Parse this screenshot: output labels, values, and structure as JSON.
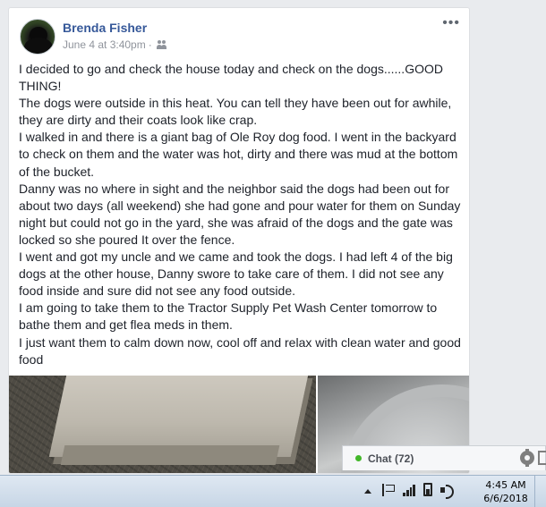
{
  "post": {
    "author": "Brenda Fisher",
    "timestamp": "June 4 at 3:40pm",
    "separator": "·",
    "more_label": "•••",
    "paragraphs": [
      "I decided to go and check the house today and check on the dogs......GOOD THING!",
      "The dogs were outside in this heat. You can tell they have been out for awhile, they are dirty and their coats look like crap.",
      "I walked in and there is a giant bag of Ole Roy dog food. I went in the backyard to check on them and the water was hot, dirty and there was mud at the bottom of the bucket.",
      "Danny was no where in sight and the neighbor said the dogs had been out for about two days (all weekend) she had gone and pour water for them on Sunday night but could not go in the yard, she was afraid of the dogs and the gate was locked so she poured It over the fence.",
      "I went and got my uncle and we came and took the dogs. I had left 4 of the big dogs at the other house, Danny swore to take care of them. I did not see any food inside and sure did not see any food outside.",
      "I am going to take them to the Tractor Supply Pet Wash Center tomorrow to bathe them and get flea meds in them.",
      "I just want them to calm down now, cool off and relax with clean water and good food"
    ]
  },
  "chat": {
    "label": "Chat (72)"
  },
  "taskbar": {
    "time": "4:45 AM",
    "date": "6/6/2018"
  }
}
